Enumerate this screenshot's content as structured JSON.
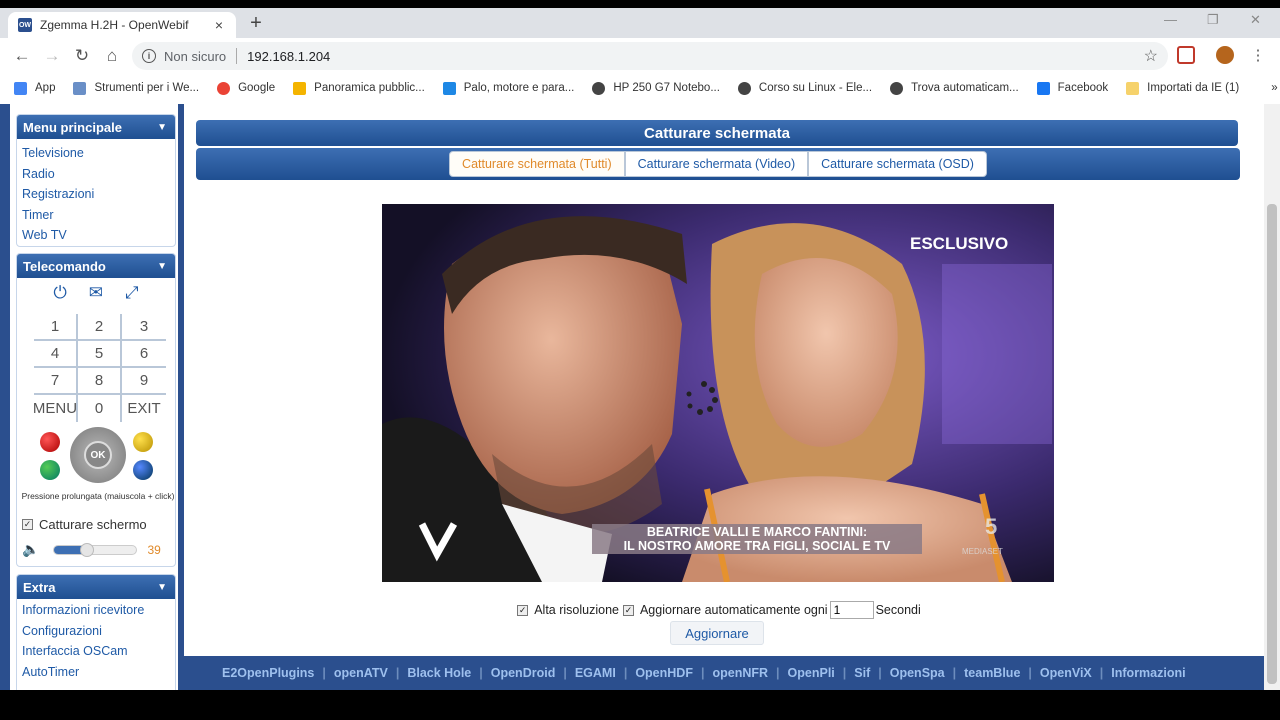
{
  "browser": {
    "tab_title": "Zgemma H.2H - OpenWebif",
    "tab_close": "×",
    "new_tab": "+",
    "security_label": "Non sicuro",
    "url": "192.168.1.204",
    "bookmarks": [
      "App",
      "Strumenti per i We...",
      "Google",
      "Panoramica pubblic...",
      "Palo, motore e para...",
      "HP 250 G7 Notebo...",
      "Corso su Linux - Ele...",
      "Trova automaticam...",
      "Facebook",
      "Importati da IE (1)"
    ],
    "bookmarks_more": "»"
  },
  "sidebar": {
    "main_menu": {
      "title": "Menu principale",
      "items": [
        "Televisione",
        "Radio",
        "Registrazioni",
        "Timer",
        "Web TV"
      ]
    },
    "remote": {
      "title": "Telecomando",
      "keys": [
        "1",
        "2",
        "3",
        "4",
        "5",
        "6",
        "7",
        "8",
        "9",
        "MENU",
        "0",
        "EXIT"
      ],
      "ok_label": "OK",
      "hint": "Pressione prolungata (maiuscola + click)",
      "capture_label": "Catturare schermo",
      "volume_value": "39",
      "volume_fraction": 0.39
    },
    "extra": {
      "title": "Extra",
      "items": [
        "Informazioni ricevitore",
        "Configurazioni",
        "Interfaccia OSCam",
        "AutoTimer"
      ]
    }
  },
  "main": {
    "title": "Catturare schermata",
    "tabs": [
      "Catturare schermata (Tutti)",
      "Catturare schermata (Video)",
      "Catturare schermata (OSD)"
    ],
    "screenshot": {
      "logo": "ESCLUSIVO",
      "caption_line1": "BEATRICE VALLI E MARCO FANTINI:",
      "caption_line2": "IL NOSTRO AMORE TRA FIGLI, SOCIAL E TV",
      "channel": "MEDIASET"
    },
    "high_res_label": "Alta risoluzione",
    "auto_refresh_label": "Aggiornare automaticamente ogni",
    "interval_value": "1",
    "seconds_label": "Secondi",
    "refresh_button": "Aggiornare"
  },
  "footer": {
    "links": [
      "E2OpenPlugins",
      "openATV",
      "Black Hole",
      "OpenDroid",
      "EGAMI",
      "OpenHDF",
      "openNFR",
      "OpenPli",
      "Sif",
      "OpenSpa",
      "teamBlue",
      "OpenViX",
      "Informazioni"
    ]
  },
  "colors": {
    "header_blue": "#2b4f8e",
    "link_blue": "#1f5aa6",
    "accent_orange": "#e08a2b"
  }
}
